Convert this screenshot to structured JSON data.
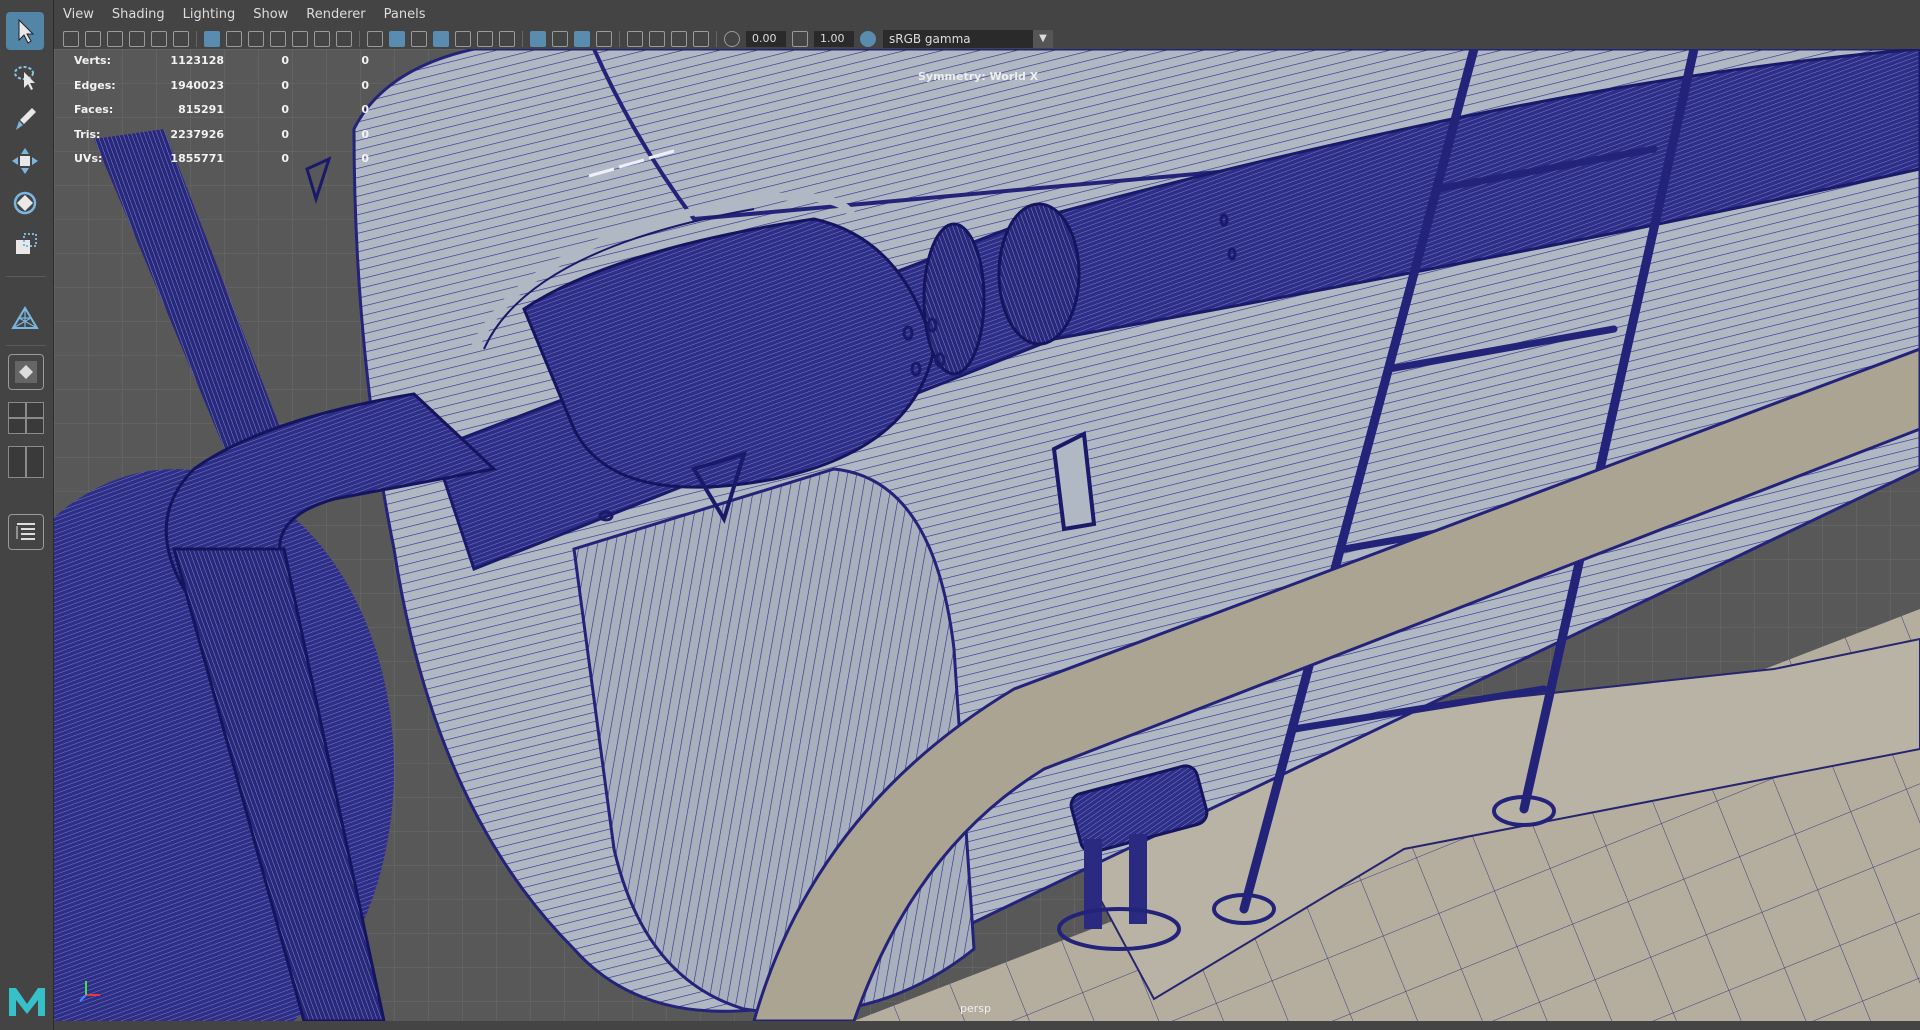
{
  "menubar": {
    "items": [
      "View",
      "Shading",
      "Lighting",
      "Show",
      "Renderer",
      "Panels"
    ]
  },
  "toolbar": {
    "exposure_value": "0.00",
    "gamma_value": "1.00",
    "color_space": "sRGB gamma"
  },
  "hud": {
    "rows": [
      {
        "label": "Verts:",
        "value": "1123128",
        "c1": "0",
        "c2": "0"
      },
      {
        "label": "Edges:",
        "value": "1940023",
        "c1": "0",
        "c2": "0"
      },
      {
        "label": "Faces:",
        "value": "815291",
        "c1": "0",
        "c2": "0"
      },
      {
        "label": "Tris:",
        "value": "2237926",
        "c1": "0",
        "c2": "0"
      },
      {
        "label": "UVs:",
        "value": "1855771",
        "c1": "0",
        "c2": "0"
      }
    ],
    "symmetry": "Symmetry: World X",
    "camera": "persp"
  },
  "colors": {
    "wire": "#1a1a7a",
    "background_grey": "#5c5c5c",
    "surface": "#a9b1bd",
    "active_tool": "#5285a6"
  },
  "icons": {
    "toolbox": [
      "select-arrow-icon",
      "lasso-select-icon",
      "paint-select-icon",
      "move-icon",
      "rotate-icon",
      "scale-icon",
      "modeling-toolkit-icon",
      "layout-single-icon",
      "layout-four-icon",
      "layout-two-icon",
      "outliner-icon",
      "maya-logo-icon"
    ]
  }
}
